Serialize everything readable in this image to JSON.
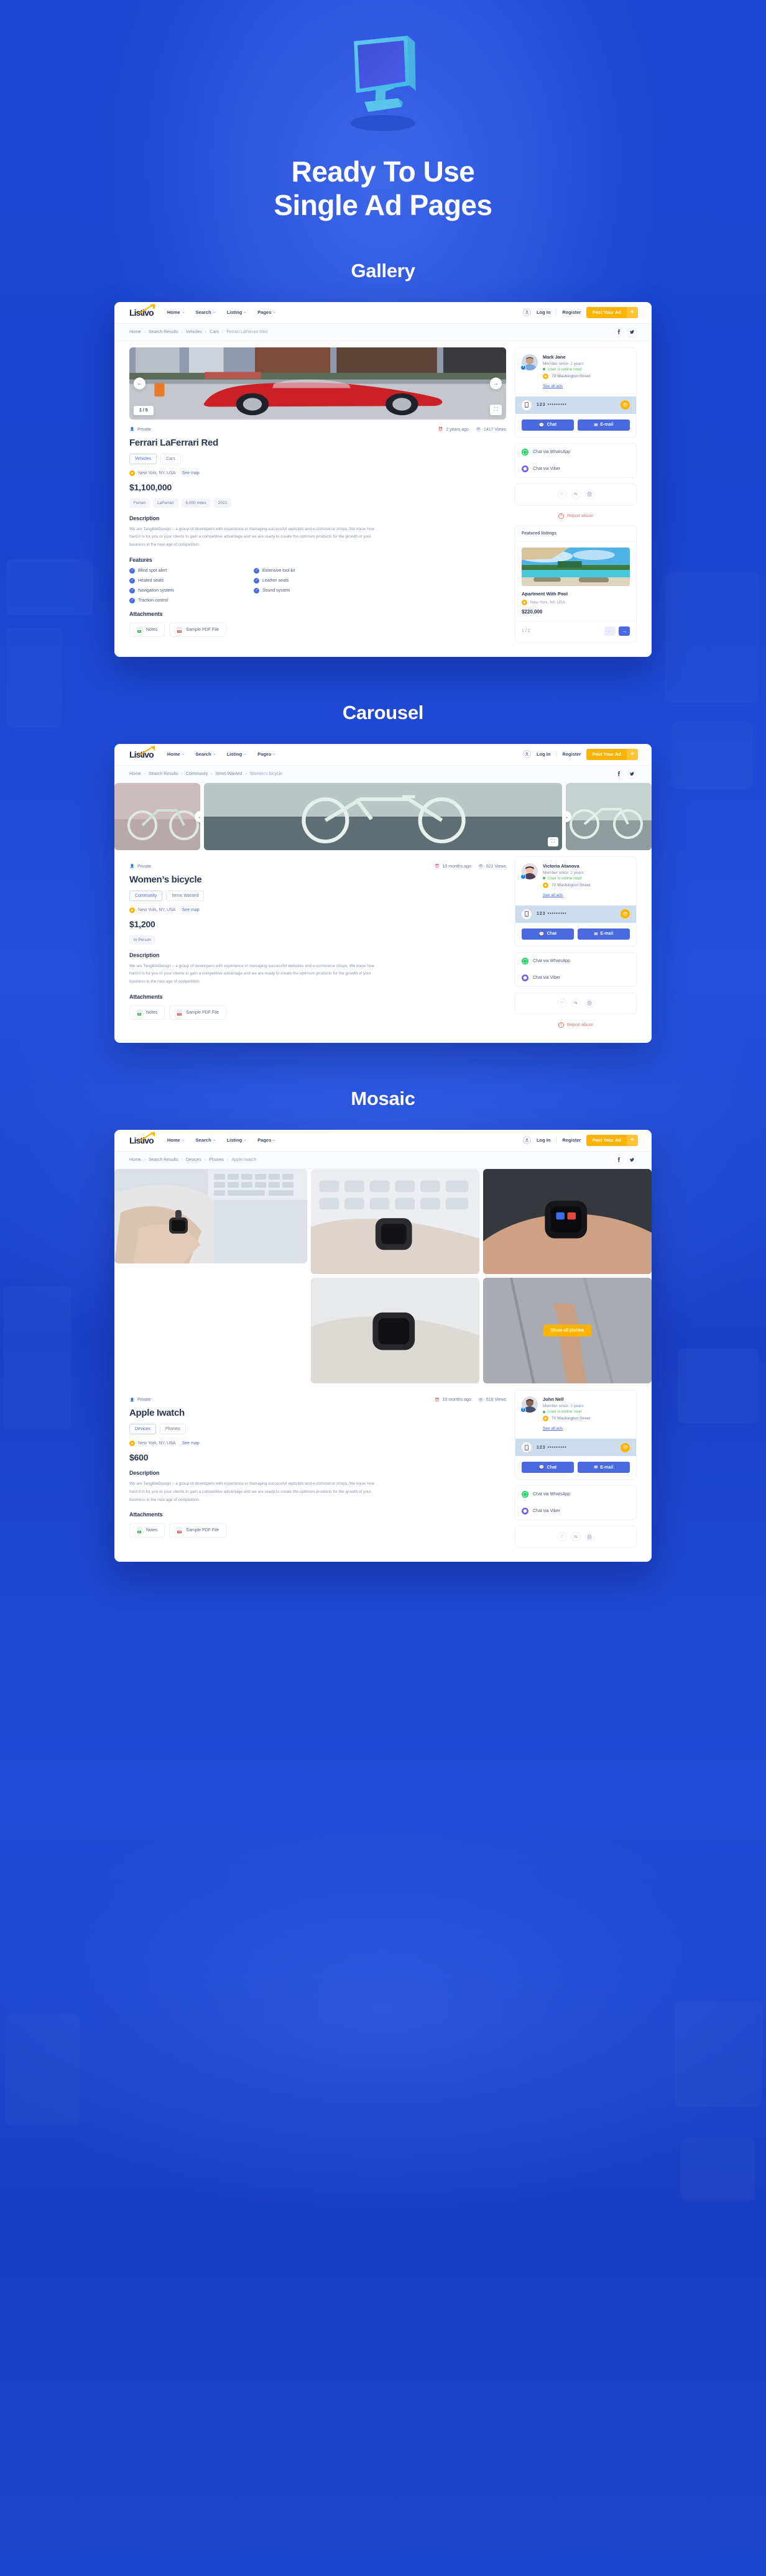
{
  "hero": {
    "title_line1": "Ready To Use",
    "title_line2": "Single Ad Pages",
    "monitor_icon": "monitor-icon"
  },
  "colors": {
    "background": "#1a49d6",
    "accent_blue": "#4c6ae0",
    "accent_yellow": "#ffb300",
    "online_green": "#4cb863",
    "report_red": "#ef6b6b",
    "whatsapp_green": "#25d366",
    "viber_purple": "#7360f2"
  },
  "nav": {
    "logo": "Listivo",
    "links": [
      "Home",
      "Search",
      "Listing",
      "Pages"
    ],
    "login": "Log In",
    "register": "Register",
    "post_ad": "Post Your Ad",
    "post_ad_plus": "+",
    "facebook_icon": "facebook-icon",
    "twitter_icon": "twitter-icon"
  },
  "common": {
    "private_label": "Private",
    "see_map": "See map",
    "description_heading": "Description",
    "description_text": "We are TangibleDesign – a group of developers with experience in managing successful websites and e-commerce shops. We know how hard it is for you or your clients to gain a competitive advantage and we are ready to create the optimum products for the growth of your business in the new age of competition.",
    "features_heading": "Features",
    "attachments_heading": "Attachments",
    "attachments": [
      "Notes",
      "Sample PDF File"
    ],
    "member_since": "Member since: 2 years",
    "online_now": "User is online now!",
    "address": "70 Washington Street",
    "see_all_ads": "See all ads",
    "phone_masked": "123 •••••••••",
    "chat_button": "Chat",
    "email_button": "E-mail",
    "chat_whatsapp": "Chat via WhatsApp",
    "chat_viber": "Chat via Viber",
    "report_abuse": "Report abuse",
    "heart_icon": "heart-icon",
    "compare_icon": "compare-icon",
    "print_icon": "print-icon"
  },
  "sections": [
    {
      "heading": "Gallery",
      "breadcrumb": [
        "Home",
        "Search Results",
        "Vehicles",
        "Cars",
        "Ferrari LaFerrari Red"
      ],
      "image_counter": "1 / 5",
      "listing": {
        "posted": "2 years ago",
        "views": "1417 Views",
        "title": "Ferrari LaFerrari Red",
        "categories": [
          "Vehicles",
          "Cars"
        ],
        "location": "New York, NY, USA",
        "price": "$1,100,000",
        "specs": [
          "Ferrari",
          "LaFerrari",
          "5,000 miles",
          "2021"
        ],
        "features": [
          "Blind spot alert",
          "Extensive tool kit",
          "Heated seats",
          "Leather seats",
          "Navigation system",
          "Sound system",
          "Traction control"
        ]
      },
      "seller": {
        "name": "Mark Jane"
      },
      "featured": {
        "heading": "Featured listings",
        "name": "Apartment With Pool",
        "location": "New York, NY, USA",
        "price": "$220,000",
        "counter": "1 / 2"
      }
    },
    {
      "heading": "Carousel",
      "breadcrumb": [
        "Home",
        "Search Results",
        "Community",
        "Items Wanted",
        "Women’s bicycle"
      ],
      "listing": {
        "posted": "10 months ago",
        "views": "921 Views",
        "title": "Women’s bicycle",
        "categories": [
          "Community",
          "Items Wanted"
        ],
        "location": "New York, NY, USA",
        "price": "$1,200",
        "specs": [
          "In Person"
        ]
      },
      "seller": {
        "name": "Victoria Atanova"
      }
    },
    {
      "heading": "Mosaic",
      "breadcrumb": [
        "Home",
        "Search Results",
        "Devices",
        "Phones",
        "Apple Iwatch"
      ],
      "show_all_photos": "Show all photos",
      "listing": {
        "posted": "10 months ago",
        "views": "616 Views",
        "title": "Apple Iwatch",
        "categories": [
          "Devices",
          "Phones"
        ],
        "location": "New York, NY, USA",
        "price": "$600",
        "specs": []
      },
      "seller": {
        "name": "John Nell"
      }
    }
  ]
}
